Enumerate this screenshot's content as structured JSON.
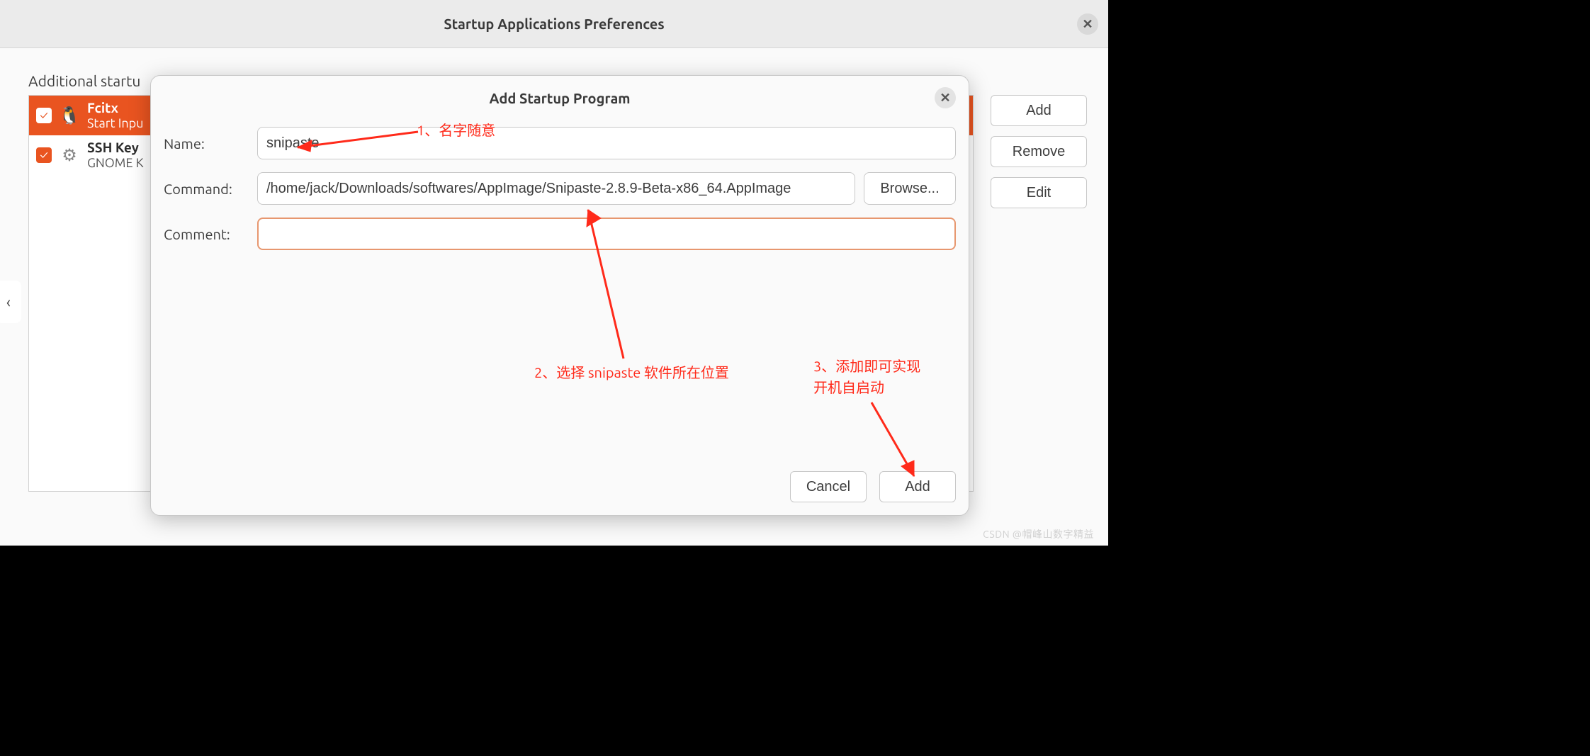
{
  "window": {
    "title": "Startup Applications Preferences",
    "additional_label": "Additional startu",
    "close_glyph": "✕"
  },
  "list": {
    "items": [
      {
        "title": "Fcitx",
        "sub": "Start Inpu",
        "icon": "🐧",
        "selected": true
      },
      {
        "title": "SSH Key",
        "sub": "GNOME K",
        "icon": "⚙",
        "selected": false
      }
    ]
  },
  "side": {
    "add": "Add",
    "remove": "Remove",
    "edit": "Edit"
  },
  "modal": {
    "title": "Add Startup Program",
    "close_glyph": "✕",
    "labels": {
      "name": "Name:",
      "command": "Command:",
      "comment": "Comment:"
    },
    "values": {
      "name": "snipaste",
      "command": "/home/jack/Downloads/softwares/AppImage/Snipaste-2.8.9-Beta-x86_64.AppImage",
      "comment": ""
    },
    "browse": "Browse...",
    "cancel": "Cancel",
    "add": "Add"
  },
  "annotations": {
    "a1": "1、名字随意",
    "a2": "2、选择 snipaste 软件所在位置",
    "a3_line1": "3、添加即可实现",
    "a3_line2": "开机自启动"
  },
  "watermark": "CSDN @帽峰山数字精益"
}
